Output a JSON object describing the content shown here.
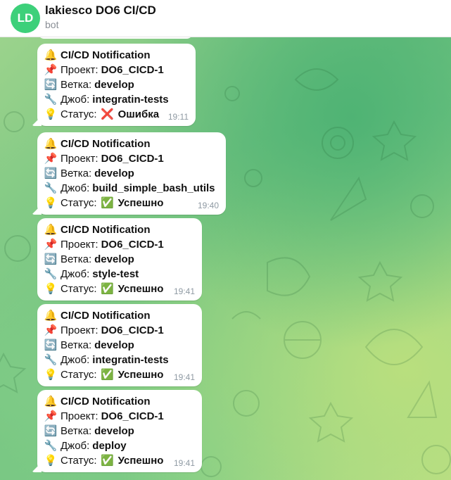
{
  "header": {
    "avatar_initials": "LD",
    "avatar_color": "#3dd07a",
    "title": "lakiesco DO6 CI/CD",
    "subtitle": "bot"
  },
  "labels": {
    "project": "Проект:",
    "branch": "Ветка:",
    "job": "Джоб:",
    "status": "Статус:"
  },
  "messages": [
    {
      "title": "CI/CD Notification",
      "project": "DO6_CICD-1",
      "branch": "develop",
      "job": "integratin-tests",
      "status_icon": "cross-mark-icon",
      "status": "Ошибка",
      "time": "19:11"
    },
    {
      "title": "CI/CD Notification",
      "project": "DO6_CICD-1",
      "branch": "develop",
      "job": "build_simple_bash_utils",
      "status_icon": "check-mark-icon",
      "status": "Успешно",
      "time": "19:40"
    },
    {
      "title": "CI/CD Notification",
      "project": "DO6_CICD-1",
      "branch": "develop",
      "job": "style-test",
      "status_icon": "check-mark-icon",
      "status": "Успешно",
      "time": "19:41"
    },
    {
      "title": "CI/CD Notification",
      "project": "DO6_CICD-1",
      "branch": "develop",
      "job": "integratin-tests",
      "status_icon": "check-mark-icon",
      "status": "Успешно",
      "time": "19:41"
    },
    {
      "title": "CI/CD Notification",
      "project": "DO6_CICD-1",
      "branch": "develop",
      "job": "deploy",
      "status_icon": "check-mark-icon",
      "status": "Успешно",
      "time": "19:41"
    }
  ],
  "colors": {
    "success": "#2eb84b",
    "error": "#e0322f",
    "time": "#8f9aa3"
  }
}
